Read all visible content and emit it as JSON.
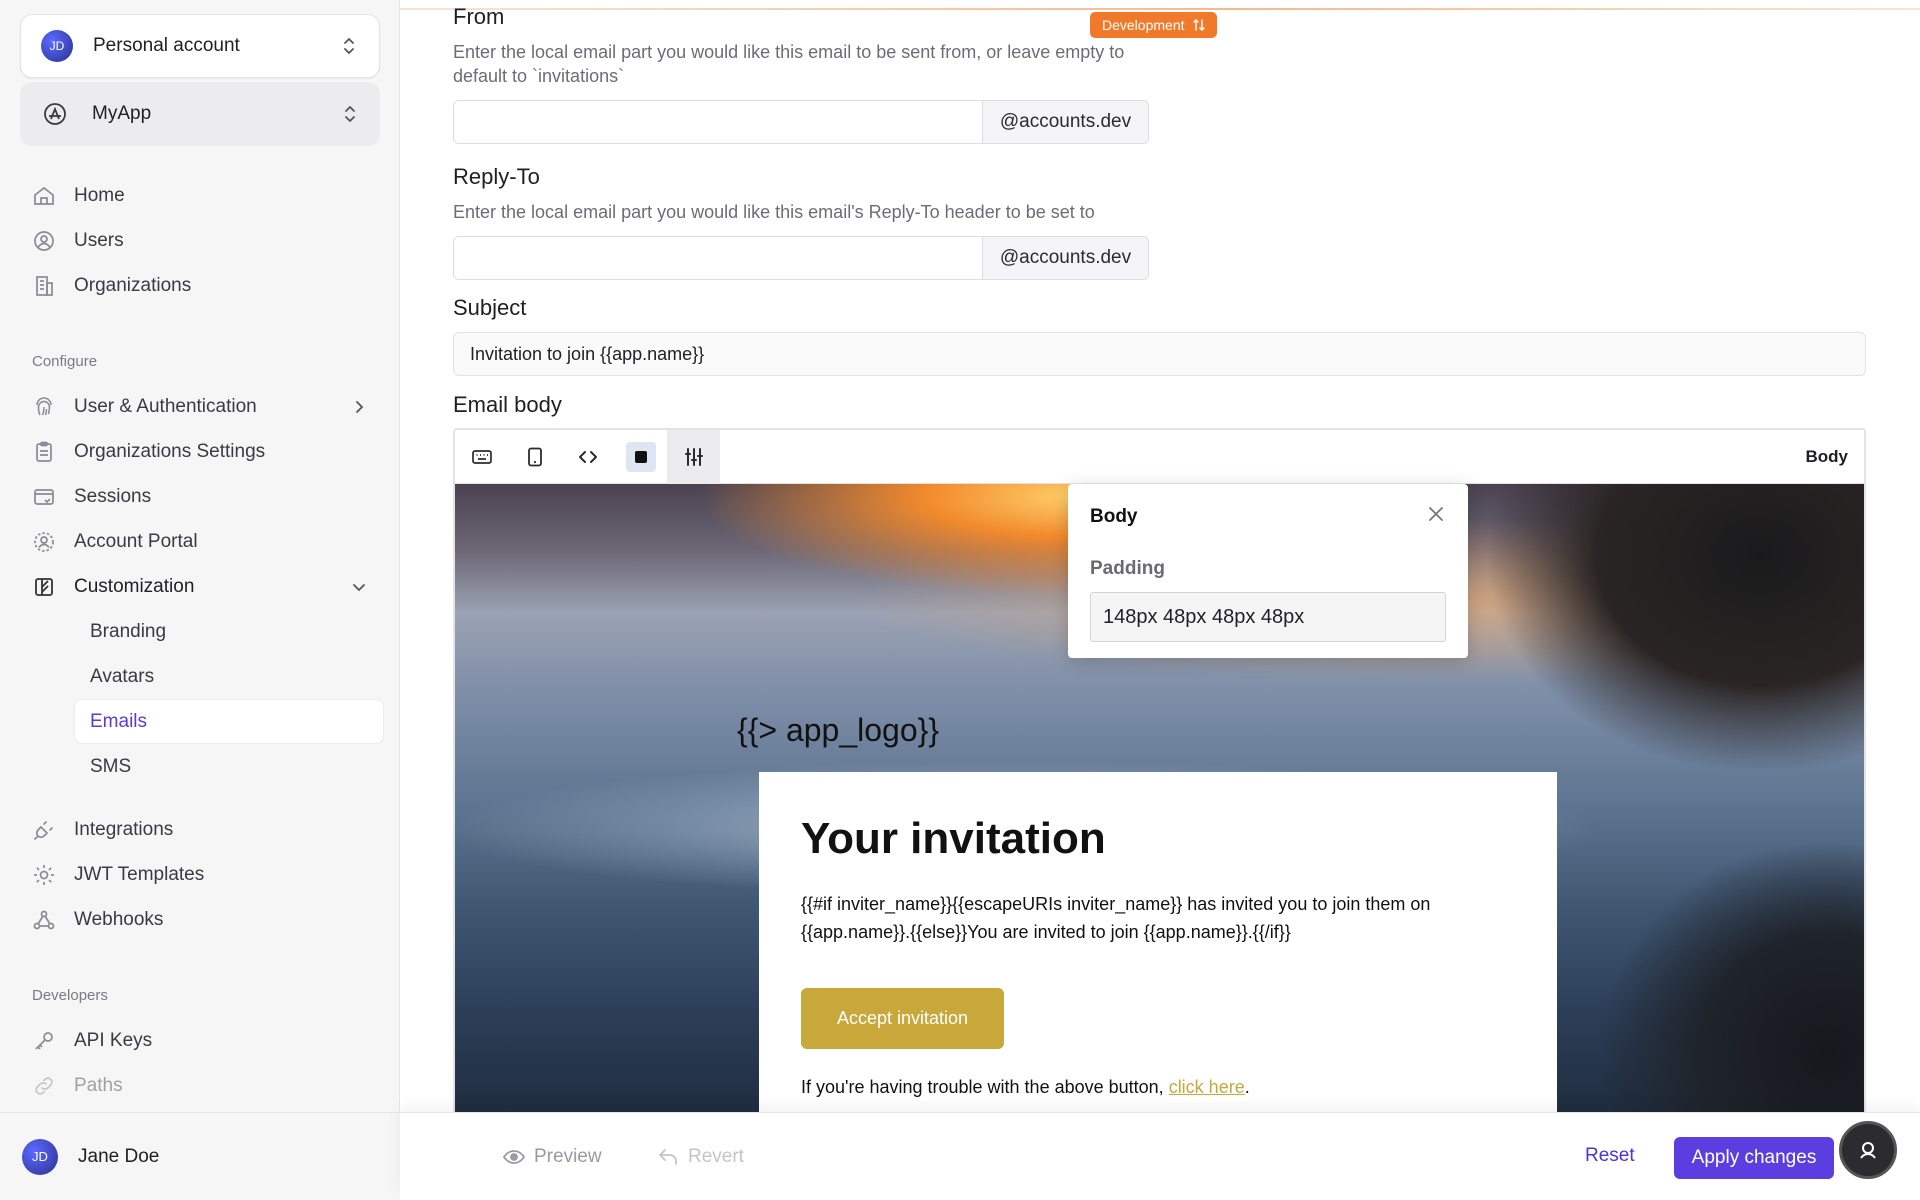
{
  "sidebar": {
    "account_switcher": {
      "avatar_initials": "JD",
      "label": "Personal account"
    },
    "app_switcher": {
      "label": "MyApp"
    },
    "main_nav": [
      {
        "label": "Home"
      },
      {
        "label": "Users"
      },
      {
        "label": "Organizations"
      }
    ],
    "configure": {
      "title": "Configure",
      "items": [
        {
          "label": "User & Authentication"
        },
        {
          "label": "Organizations Settings"
        },
        {
          "label": "Sessions"
        },
        {
          "label": "Account Portal"
        },
        {
          "label": "Customization"
        }
      ],
      "customization_sub": [
        {
          "label": "Branding"
        },
        {
          "label": "Avatars"
        },
        {
          "label": "Emails"
        },
        {
          "label": "SMS"
        }
      ],
      "more": [
        {
          "label": "Integrations"
        },
        {
          "label": "JWT Templates"
        },
        {
          "label": "Webhooks"
        }
      ]
    },
    "developers": {
      "title": "Developers",
      "items": [
        {
          "label": "API Keys"
        },
        {
          "label": "Paths"
        }
      ]
    },
    "user": {
      "avatar_initials": "JD",
      "name": "Jane Doe"
    }
  },
  "env_badge": {
    "label": "Development"
  },
  "form": {
    "from": {
      "label": "From",
      "help": "Enter the local email part you would like this email to be sent from, or leave empty to default to `invitations`",
      "value": "",
      "suffix": "@accounts.dev"
    },
    "reply_to": {
      "label": "Reply-To",
      "help": "Enter the local email part you would like this email's Reply-To header to be set to",
      "value": "",
      "suffix": "@accounts.dev"
    },
    "subject": {
      "label": "Subject",
      "value": "Invitation to join {{app.name}}"
    },
    "email_body": {
      "label": "Email body"
    }
  },
  "editor": {
    "selected_element": "Body",
    "logo_placeholder": "{{> app_logo}}",
    "card": {
      "title": "Your invitation",
      "body": "{{#if inviter_name}}{{escapeURIs inviter_name}} has invited you to join them on {{app.name}}.{{else}}You are invited to join {{app.name}}.{{/if}}",
      "button": "Accept invitation",
      "footer_text": "If you're having trouble with the above button, ",
      "footer_link": "click here",
      "footer_end": "."
    },
    "popover": {
      "title": "Body",
      "field_label": "Padding",
      "field_value": "148px 48px 48px 48px"
    }
  },
  "footer": {
    "preview": "Preview",
    "revert": "Revert",
    "reset": "Reset",
    "apply": "Apply changes"
  }
}
